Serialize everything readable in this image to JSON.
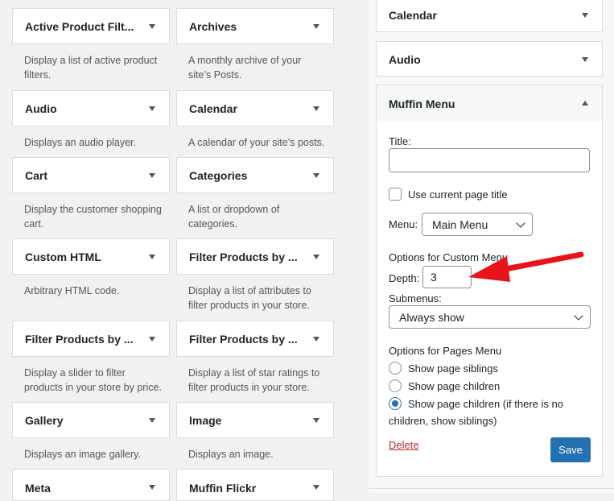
{
  "available_widgets": [
    {
      "title": "Active Product Filt...",
      "desc": "Display a list of active product filters."
    },
    {
      "title": "Archives",
      "desc": "A monthly archive of your site’s Posts."
    },
    {
      "title": "Audio",
      "desc": "Displays an audio player."
    },
    {
      "title": "Calendar",
      "desc": "A calendar of your site’s posts."
    },
    {
      "title": "Cart",
      "desc": "Display the customer shopping cart."
    },
    {
      "title": "Categories",
      "desc": "A list or dropdown of categories."
    },
    {
      "title": "Custom HTML",
      "desc": "Arbitrary HTML code."
    },
    {
      "title": "Filter Products by ...",
      "desc": "Display a list of attributes to filter products in your store."
    },
    {
      "title": "Filter Products by ...",
      "desc": "Display a slider to filter products in your store by price."
    },
    {
      "title": "Filter Products by ...",
      "desc": "Display a list of star ratings to filter products in your store."
    },
    {
      "title": "Gallery",
      "desc": "Displays an image gallery."
    },
    {
      "title": "Image",
      "desc": "Displays an image."
    },
    {
      "title": "Meta",
      "desc": ""
    },
    {
      "title": "Muffin Flickr",
      "desc": ""
    }
  ],
  "sidebar_widgets": {
    "calendar": "Calendar",
    "audio": "Audio",
    "muffin_menu": "Muffin Menu"
  },
  "form": {
    "title_label": "Title:",
    "title_value": "",
    "use_current_title_label": "Use current page title",
    "menu_label": "Menu:",
    "menu_value": "Main Menu",
    "custom_menu_heading": "Options for Custom Menu",
    "depth_label": "Depth:",
    "depth_value": "3",
    "submenus_label": "Submenus:",
    "submenus_value": "Always show",
    "pages_menu_heading": "Options for Pages Menu",
    "radio_siblings": "Show page siblings",
    "radio_children": "Show page children",
    "radio_children_or_siblings_line1": "Show page children (if there is no",
    "radio_children_or_siblings_line2": "children, show siblings)",
    "delete_label": "Delete",
    "save_label": "Save"
  },
  "colors": {
    "accent": "#2271b1",
    "annotation_arrow": "#e8141c",
    "delete": "#b32d2e"
  }
}
